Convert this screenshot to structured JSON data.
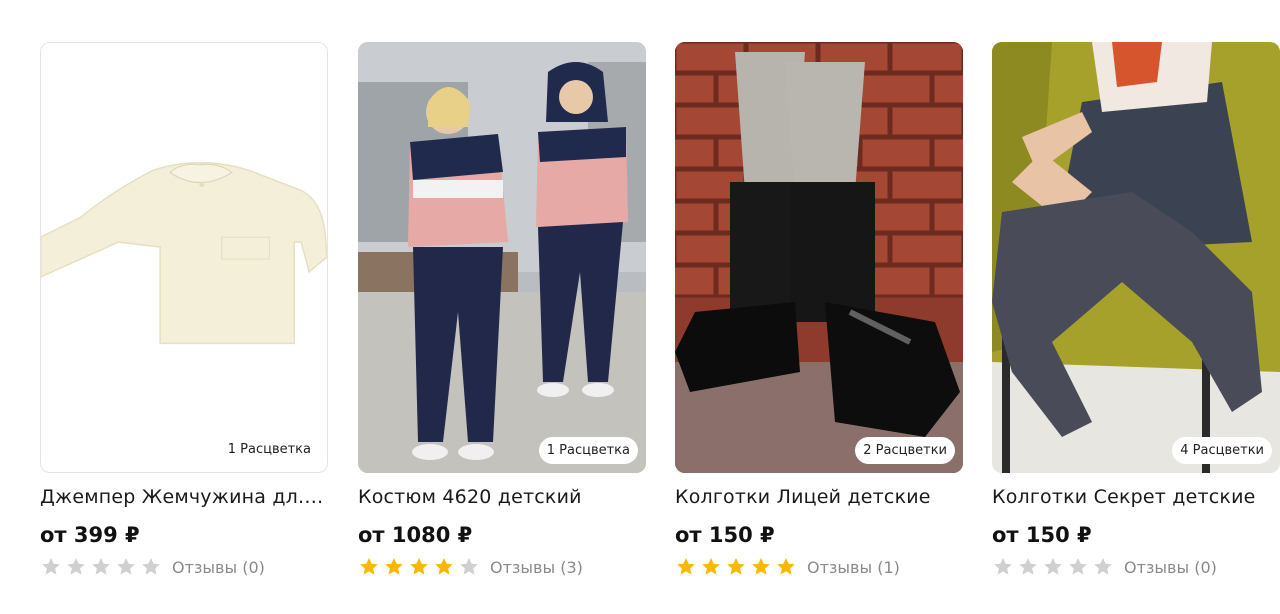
{
  "colors": {
    "star_filled": "#fbb800",
    "star_empty": "#d0d0d0",
    "price_text": "#111111",
    "muted_text": "#8a8a8a"
  },
  "products": [
    {
      "title": "Джемпер Жемчужина дл. р...",
      "price": "от 399 ₽",
      "badge": "1 Расцветка",
      "rating": 0,
      "reviews": "Отзывы (0)",
      "image": "cream-sweater-photo"
    },
    {
      "title": "Костюм 4620 детский",
      "price": "от 1080 ₽",
      "badge": "1 Расцветка",
      "rating": 4,
      "reviews": "Отзывы (3)",
      "image": "girl-tracksuit-photo"
    },
    {
      "title": "Колготки Лицей детские",
      "price": "от 150 ₽",
      "badge": "2 Расцветки",
      "rating": 5,
      "reviews": "Отзывы (1)",
      "image": "tights-boots-photo"
    },
    {
      "title": "Колготки Секрет детские",
      "price": "от 150 ₽",
      "badge": "4 Расцветки",
      "rating": 0,
      "reviews": "Отзывы (0)",
      "image": "grey-tights-chair-photo"
    }
  ]
}
